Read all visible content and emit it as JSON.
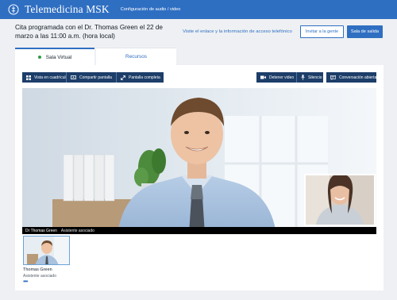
{
  "header": {
    "brand": "Telemedicina MSK",
    "settings_link": "Configuración de audio / video"
  },
  "appointment": {
    "text": "Cita programada con el Dr. Thomas Green el 22 de marzo a las 11:00 a.m. (hora local)",
    "access_link": "Visite el enlace y la información de acceso telefónico",
    "invite_button": "Invitar a la gente",
    "exit_button": "Sala de salida"
  },
  "tabs": [
    {
      "label": "Sala Virtual",
      "active": true
    },
    {
      "label": "Recursos",
      "active": false
    }
  ],
  "toolbar": {
    "grid_view": "Vista en cuadrícula",
    "share_screen": "Compartir pantalla",
    "fullscreen": "Pantalla completa",
    "stop_video": "Detener video",
    "mute": "Silencio",
    "open_chat": "Conversación abierta"
  },
  "video": {
    "speaker_name": "Dr Thomas Green",
    "speaker_role": "Asistente asociado"
  },
  "participants": [
    {
      "name": "Thomas Green",
      "role": "Asistente asociado",
      "more": "•••"
    }
  ],
  "colors": {
    "primary": "#2f6fc2",
    "toolbar": "#1d3e69",
    "active_dot": "#2e9a48"
  }
}
